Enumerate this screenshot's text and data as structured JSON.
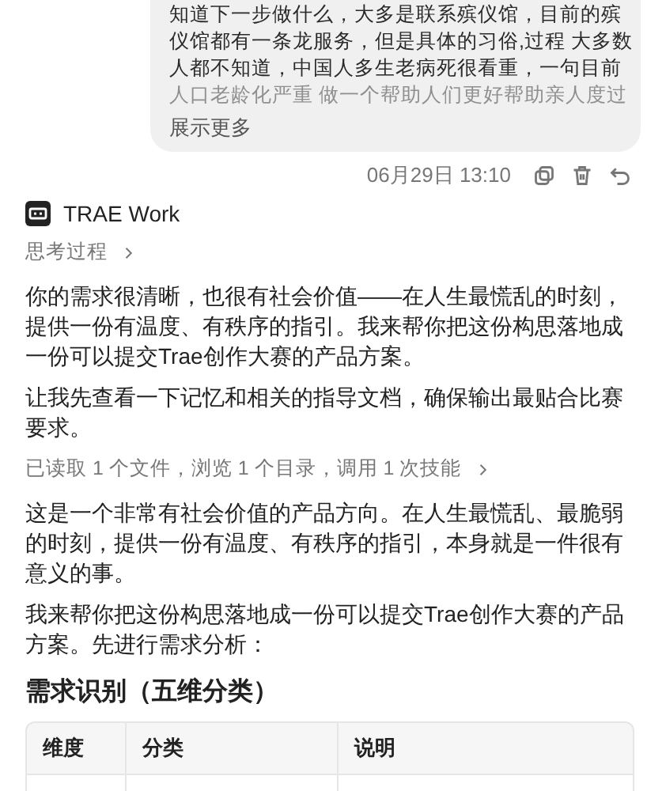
{
  "user_message": {
    "lines": [
      "知道下一步做什么，大多是联系殡仪馆，目前的殡",
      "仪馆都有一条龙服务，但是具体的习俗,过程 大多数",
      "人都不知道，中国人多生老病死很看重，一句目前",
      "人口老龄化严重 做一个帮助人们更好帮助亲人度过"
    ],
    "expand_link": "展示更多",
    "timestamp": "06月29日 13:10"
  },
  "assistant": {
    "name": "TRAE Work",
    "thinking_toggle": "思考过程",
    "paragraphs": [
      "你的需求很清晰，也很有社会价值——在人生最慌乱的时刻，提供一份有温度、有秩序的指引。我来帮你把这份构思落地成一份可以提交Trae创作大赛的产品方案。",
      "让我先查看一下记忆和相关的指导文档，确保输出最贴合比赛要求。"
    ],
    "tool_summary": "已读取 1 个文件，浏览 1 个目录，调用 1 次技能",
    "paragraphs_after": [
      "这是一个非常有社会价值的产品方向。在人生最慌乱、最脆弱的时刻，提供一份有温度、有秩序的指引，本身就是一件很有意义的事。",
      "我来帮你把这份构思落地成一份可以提交Trae创作大赛的产品方案。先进行需求分析："
    ],
    "heading": "需求识别（五维分类）",
    "table": {
      "columns": [
        "维度",
        "分类",
        "说明"
      ]
    }
  }
}
